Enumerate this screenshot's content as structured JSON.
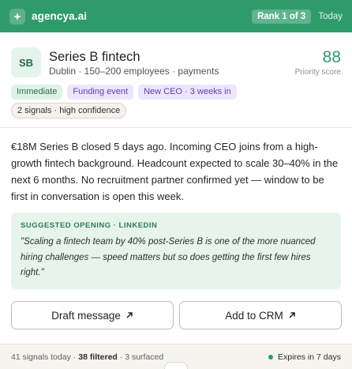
{
  "header": {
    "brand": "agencya.ai",
    "rank": "Rank 1 of 3",
    "date": "Today"
  },
  "company": {
    "initials": "SB",
    "name": "Series B fintech",
    "meta": "Dublin · 150–200 employees · payments",
    "score": "88",
    "score_label": "Priority score"
  },
  "tags": [
    "Immediate",
    "Funding event",
    "New CEO · 3 weeks in"
  ],
  "signals": "2 signals · high confidence",
  "summary": "€18M Series B closed 5 days ago. Incoming CEO joins from a high-growth fintech background. Headcount expected to scale 30–40% in the next 6 months. No recruitment partner confirmed yet — window to be first in conversation is open this week.",
  "suggested_opening": {
    "label": "SUGGESTED OPENING · LINKEDIN",
    "quote": "\"Scaling a fintech team by 40% post-Series B is one of the more nuanced hiring challenges — speed matters but so does getting the first few hires right.\""
  },
  "actions": {
    "draft": "Draft message",
    "crm": "Add to CRM"
  },
  "footer": {
    "signals_today": "41 signals today",
    "filtered": "38 filtered",
    "surfaced": "3 surfaced",
    "expires": "Expires in 7 days"
  },
  "colors": {
    "brand": "#2f9b6b",
    "tag_green_bg": "#dff2e7",
    "tag_purple_bg": "#ebe6fb",
    "suggest_bg": "#e7f4ec"
  },
  "icons": {
    "logo": "spark-icon",
    "external": "arrow-up-right-icon"
  }
}
